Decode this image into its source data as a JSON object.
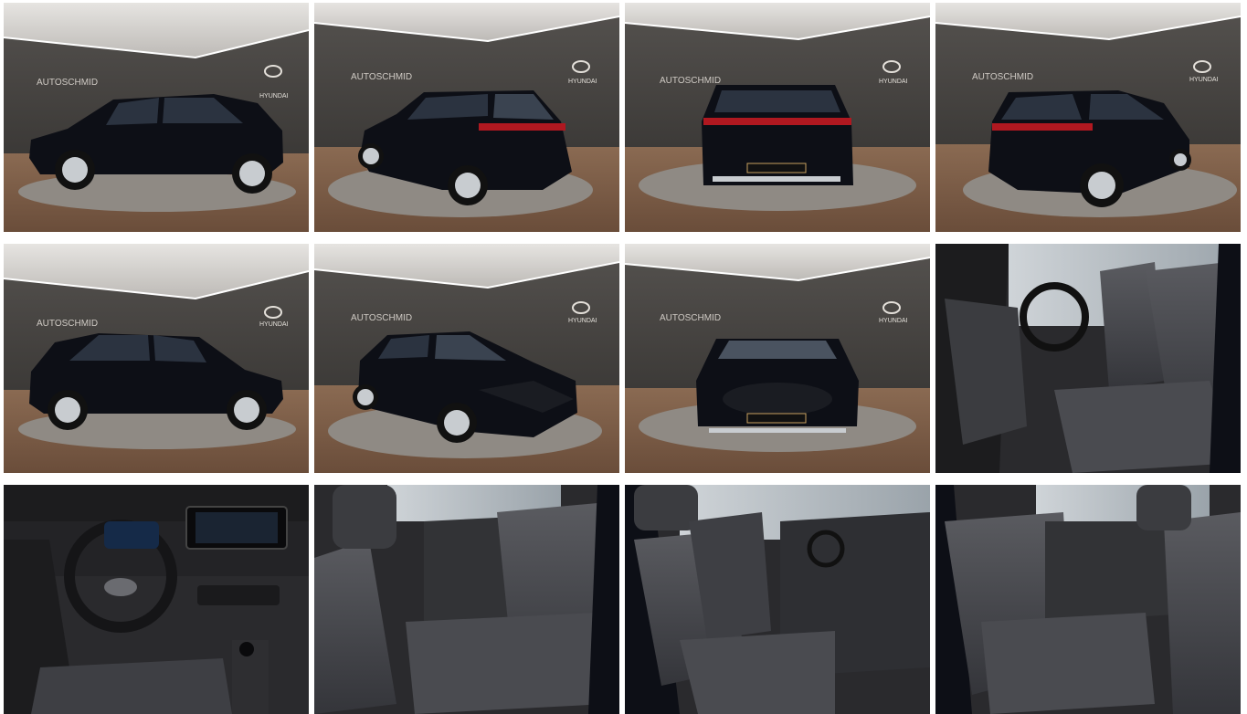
{
  "gallery": {
    "dealer_logo": "AUTOSCHMID",
    "make_logo": "HYUNDAI",
    "colors": {
      "car_body": "#0d0f16",
      "showroom_wall": "#3a3836",
      "floor": "#7a5a44",
      "turntable": "#8f8a84",
      "seat_fabric": "#4a4b50",
      "tail_light": "#b01820"
    },
    "photos": [
      {
        "view": "exterior-side-left",
        "icon": "car-side-icon"
      },
      {
        "view": "exterior-rear-left",
        "icon": "car-rear-quarter-icon"
      },
      {
        "view": "exterior-rear",
        "icon": "car-rear-icon"
      },
      {
        "view": "exterior-rear-right",
        "icon": "car-rear-quarter-icon"
      },
      {
        "view": "exterior-side-right",
        "icon": "car-side-icon"
      },
      {
        "view": "exterior-front-left",
        "icon": "car-front-quarter-icon"
      },
      {
        "view": "exterior-front",
        "icon": "car-front-icon"
      },
      {
        "view": "interior-front-seats",
        "icon": "seat-icon"
      },
      {
        "view": "interior-dashboard",
        "icon": "steering-wheel-icon"
      },
      {
        "view": "interior-rear-seats-left",
        "icon": "seat-icon"
      },
      {
        "view": "interior-front-seats-right",
        "icon": "seat-icon"
      },
      {
        "view": "interior-rear-seats-right",
        "icon": "seat-icon"
      }
    ]
  }
}
